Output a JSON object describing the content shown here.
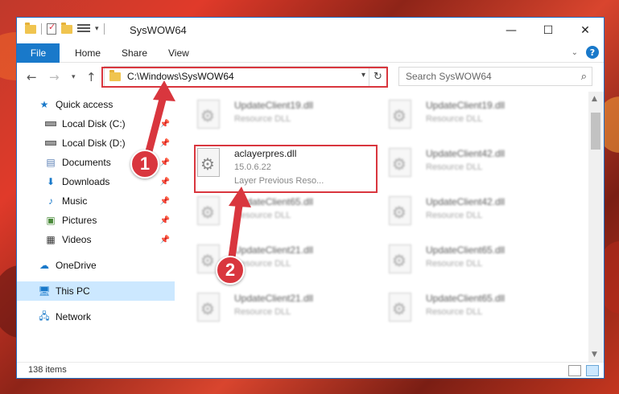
{
  "window": {
    "title": "SysWOW64"
  },
  "caption": {
    "minimize": "—",
    "maximize": "☐",
    "close": "✕"
  },
  "ribbon": {
    "tabs": [
      "File",
      "Home",
      "Share",
      "View"
    ],
    "help": "?"
  },
  "address": {
    "path": "C:\\Windows\\SysWOW64"
  },
  "search": {
    "placeholder": "Search SysWOW64"
  },
  "nav": {
    "items": [
      {
        "label": "Quick access",
        "icon": "star-icon",
        "pinned": false
      },
      {
        "label": "Local Disk (C:)",
        "icon": "drive-icon",
        "pinned": true
      },
      {
        "label": "Local Disk (D:)",
        "icon": "drive-icon",
        "pinned": true
      },
      {
        "label": "Documents",
        "icon": "document-icon",
        "pinned": true
      },
      {
        "label": "Downloads",
        "icon": "download-icon",
        "pinned": true
      },
      {
        "label": "Music",
        "icon": "music-icon",
        "pinned": true
      },
      {
        "label": "Pictures",
        "icon": "pictures-icon",
        "pinned": true
      },
      {
        "label": "Videos",
        "icon": "video-icon",
        "pinned": true
      },
      {
        "label": "OneDrive",
        "icon": "cloud-icon",
        "pinned": false
      },
      {
        "label": "This PC",
        "icon": "computer-icon",
        "pinned": false,
        "selected": true
      },
      {
        "label": "Network",
        "icon": "network-icon",
        "pinned": false
      }
    ]
  },
  "files": [
    {
      "name": "UpdateClient19.dll",
      "desc": "Resource DLL"
    },
    {
      "name": "UpdateClient19.dll",
      "desc": "Resource DLL"
    },
    {
      "name": "aclayerpres.dll",
      "version": "15.0.6.22",
      "desc": "Layer Previous Reso..."
    },
    {
      "name": "UpdateClient42.dll",
      "desc": "Resource DLL"
    },
    {
      "name": "UpdateClient65.dll",
      "desc": "Resource DLL"
    },
    {
      "name": "UpdateClient42.dll",
      "desc": "Resource DLL"
    },
    {
      "name": "UpdateClient21.dll",
      "desc": "Resource DLL"
    },
    {
      "name": "UpdateClient65.dll",
      "desc": "Resource DLL"
    },
    {
      "name": "UpdateClient21.dll",
      "desc": "Resource DLL"
    },
    {
      "name": "UpdateClient65.dll",
      "desc": "Resource DLL"
    }
  ],
  "status": {
    "count": "138 items"
  },
  "callouts": {
    "one": "1",
    "two": "2"
  },
  "colors": {
    "accent": "#1979ca",
    "highlight": "#d9363e",
    "selection": "#cce8ff"
  }
}
